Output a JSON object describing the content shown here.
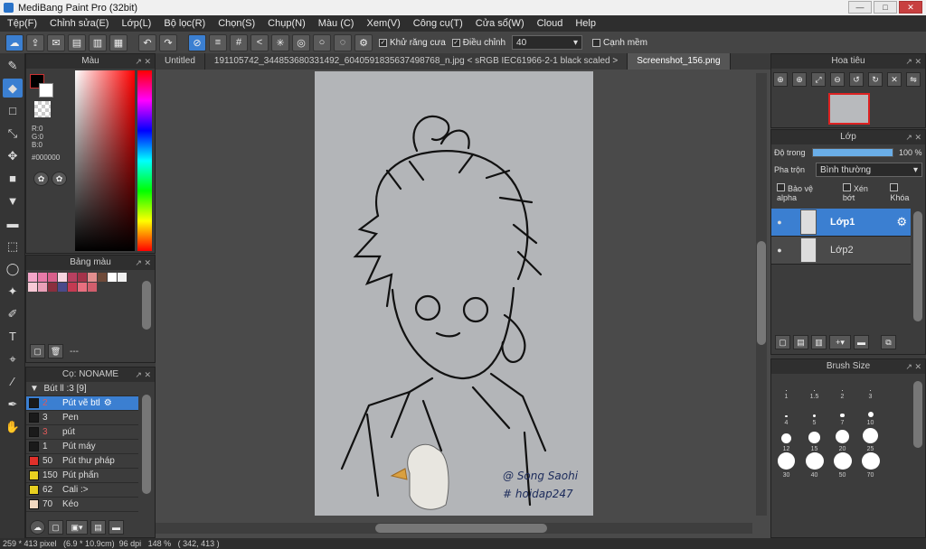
{
  "window": {
    "title": "MediBang Paint Pro (32bit)",
    "buttons": [
      "—",
      "□",
      "✕"
    ]
  },
  "menu": [
    "Tệp(F)",
    "Chỉnh sửa(E)",
    "Lớp(L)",
    "Bộ lọc(R)",
    "Chọn(S)",
    "Chụp(N)",
    "Màu (C)",
    "Xem(V)",
    "Công cụ(T)",
    "Cửa sổ(W)",
    "Cloud",
    "Help"
  ],
  "toolbar": {
    "antialias_label": "Khử răng cưa",
    "adjust_label": "Điều chỉnh",
    "adjust_value": "40",
    "soft_edge_label": "Cạnh mềm"
  },
  "color_panel": {
    "title": "Màu",
    "r": "R:0",
    "g": "G:0",
    "b": "B:0",
    "hex": "#000000"
  },
  "swatch_panel": {
    "title": "Bảng màu",
    "footer_text": "---",
    "colors": [
      "#f4a6c9",
      "#e77aa8",
      "#d95f8b",
      "#f8d6e1",
      "#b84060",
      "#a4334a",
      "#e38f8f",
      "#6f4b3a",
      "#ffffff",
      "#f1f1f1",
      "#f7c9d6",
      "#e9a0b8",
      "#8a2f3e",
      "#4a4a8a",
      "#c43a52",
      "#e86f7f",
      "#d15e6c"
    ]
  },
  "brush_panel": {
    "title": "Cọ: NONAME",
    "group": "Bút ll :3 [9]",
    "items": [
      {
        "num": "2",
        "name": "Pút vẽ btl",
        "color": "#1a1a1a",
        "selected": true
      },
      {
        "num": "3",
        "name": "Pen",
        "color": "#1a1a1a"
      },
      {
        "num": "3",
        "name": "pút",
        "color": "#1a1a1a"
      },
      {
        "num": "1",
        "name": "Pút máy",
        "color": "#1a1a1a"
      },
      {
        "num": "50",
        "name": "Pút thư pháp",
        "color": "#e0302a"
      },
      {
        "num": "150",
        "name": "Pút phấn",
        "color": "#e8d020"
      },
      {
        "num": "62",
        "name": "Cali :>",
        "color": "#e8d020"
      },
      {
        "num": "70",
        "name": "Kéo",
        "color": "#f0d8c0"
      }
    ]
  },
  "tabs": [
    "Untitled",
    "191105742_344853680331492_6040591835637498768_n.jpg < sRGB IEC61966-2-1 black scaled >",
    "Screenshot_156.png"
  ],
  "canvas": {
    "signature_line1": "@ Song Saohi",
    "signature_line2": "# hoidap247"
  },
  "navigator": {
    "title": "Hoa tiêu"
  },
  "layer_panel": {
    "title": "Lớp",
    "opacity_label": "Độ trong",
    "opacity_value": "100 %",
    "opacity_fraction": 1.0,
    "blend_label": "Pha trộn",
    "blend_value": "Bình thường",
    "alpha_label": "Bảo vệ alpha",
    "clip_label": "Xén bớt",
    "lock_label": "Khóa",
    "layers": [
      {
        "name": "Lớp1",
        "selected": true
      },
      {
        "name": "Lớp2",
        "selected": false
      }
    ]
  },
  "brush_size_panel": {
    "title": "Brush Size",
    "sizes": [
      "1",
      "1.5",
      "2",
      "3",
      "4",
      "5",
      "7",
      "10",
      "12",
      "15",
      "20",
      "25",
      "30",
      "40",
      "50",
      "70"
    ]
  },
  "status": {
    "text": "259 * 413 pixel   (6.9 * 10.9cm)  96 dpi   148 %   ( 342, 413 )"
  }
}
